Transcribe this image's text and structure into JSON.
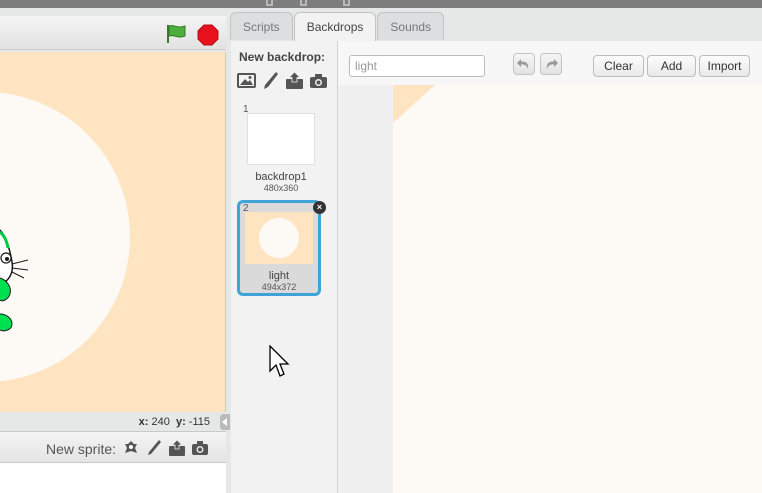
{
  "stage": {
    "coords": {
      "x_label": "x:",
      "x_value": "240",
      "y_label": "y:",
      "y_value": "-115"
    },
    "colors": {
      "backdrop": "#ffe4c2",
      "circle": "#fdfaf5"
    }
  },
  "sprites": {
    "new_sprite_label": "New sprite:",
    "icons": [
      "choose-sprite-icon",
      "paint-sprite-icon",
      "upload-sprite-icon",
      "camera-sprite-icon"
    ]
  },
  "tabs": [
    {
      "label": "Scripts",
      "active": false
    },
    {
      "label": "Backdrops",
      "active": true
    },
    {
      "label": "Sounds",
      "active": false
    }
  ],
  "new_backdrop": {
    "label": "New backdrop:",
    "icons": [
      "library-icon",
      "paint-icon",
      "upload-icon",
      "camera-icon"
    ]
  },
  "backdrops": [
    {
      "number": "1",
      "name": "backdrop1",
      "size": "480x360"
    },
    {
      "number": "2",
      "name": "light",
      "size": "494x372"
    }
  ],
  "editor": {
    "name_value": "light",
    "clear_label": "Clear",
    "add_label": "Add",
    "import_label": "Import"
  }
}
